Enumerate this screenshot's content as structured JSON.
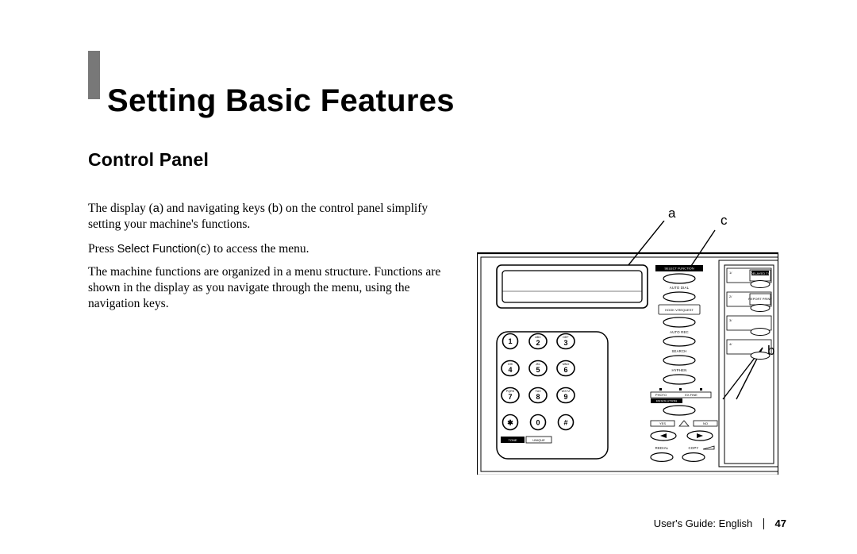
{
  "chapter_title": "Setting Basic Features",
  "section_title": "Control Panel",
  "para1_a": "The display (",
  "para1_b": ") and navigating keys (",
  "para1_c": ") on the control panel simplify setting your machine's functions.",
  "para2_a": "Press ",
  "para2_b": "Select Function",
  "para2_c": "(",
  "para2_d": ") to access the menu.",
  "para3": "The machine functions are organized in a menu structure. Functions are shown in the display as you navigate through the menu, using the navigation keys.",
  "label_a": "a",
  "label_b": "b",
  "label_c": "c",
  "key_a": "a",
  "key_b": "b",
  "key_c": "c",
  "keypad": {
    "r1": [
      "1",
      "2",
      "3"
    ],
    "r1sub": [
      "",
      "ABC",
      "DEF"
    ],
    "r2": [
      "4",
      "5",
      "6"
    ],
    "r2sub": [
      "GHI",
      "JKL",
      "MNO"
    ],
    "r3": [
      "7",
      "8",
      "9"
    ],
    "r3sub": [
      "PQRS",
      "TUV",
      "WXYZ"
    ],
    "r4": [
      "✱",
      "0",
      "#"
    ]
  },
  "bottom_labels": {
    "tone": "TONE",
    "unique": "UNIQUE"
  },
  "right_buttons": {
    "select_function": "SELECT  FUNCTION",
    "auto_dial": "AUTO DIAL",
    "hook": "HOOK V.REQUEST",
    "auto_rec": "AUTO REC",
    "search": "SEARCH",
    "hyphen": "HYPHEN",
    "photo": "PHOTO",
    "exfine": "EX.FINE",
    "resolution": "RESOLUTION",
    "redial": "REDIAL",
    "copy": "COPY",
    "yes": "YES",
    "no": "NO"
  },
  "far_right": {
    "delayed": "DELAYED TX",
    "report": "REPORT PRINT",
    "r1": "1/",
    "r2": "2/",
    "r3": "3/",
    "r4": "4/"
  },
  "footer_text": "User's Guide:  English",
  "page_number": "47"
}
